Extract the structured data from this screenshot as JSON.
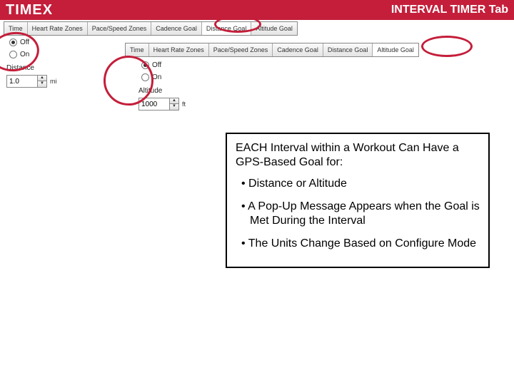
{
  "header": {
    "logo": "TIMEX",
    "title": "INTERVAL TIMER Tab"
  },
  "tabs1": {
    "t0": "Time",
    "t1": "Heart Rate Zones",
    "t2": "Pace/Speed Zones",
    "t3": "Cadence Goal",
    "t4": "Distance Goal",
    "t5": "Altitude Goal"
  },
  "tabs2": {
    "t0": "Time",
    "t1": "Heart Rate Zones",
    "t2": "Pace/Speed Zones",
    "t3": "Cadence Goal",
    "t4": "Distance Goal",
    "t5": "Altitude Goal"
  },
  "panel1": {
    "off": "Off",
    "on": "On",
    "group": "Distance",
    "value": "1.0",
    "unit": "mi"
  },
  "panel2": {
    "off": "Off",
    "on": "On",
    "group": "Altitude",
    "value": "1000",
    "unit": "ft"
  },
  "info": {
    "heading": "EACH Interval within a Workout Can Have a GPS-Based Goal for:",
    "b1": "Distance or Altitude",
    "b2": "A Pop-Up Message Appears when the Goal is Met During the Interval",
    "b3": "The Units Change Based on Configure Mode"
  }
}
